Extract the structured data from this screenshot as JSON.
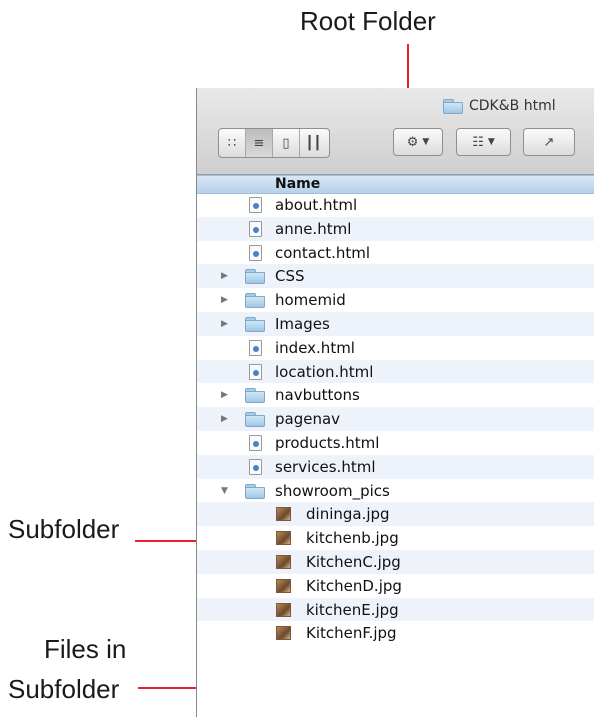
{
  "annotations": {
    "root_folder": "Root Folder",
    "subfolder": "Subfolder",
    "files_line1": "Files in",
    "files_line2": "Subfolder"
  },
  "window": {
    "title": "CDK&B html",
    "title_icon": "folder-icon"
  },
  "toolbar": {
    "view_modes": [
      "icon-view-icon",
      "list-view-icon",
      "column-view-icon",
      "coverflow-view-icon"
    ],
    "active_view": "list",
    "action_button_icon": "gear-icon",
    "arrange_button_icon": "arrange-icon",
    "share_button_icon": "share-icon"
  },
  "list": {
    "column_name": "Name",
    "rows": [
      {
        "name": "about.html",
        "type": "html",
        "expandable": false,
        "indent": 0
      },
      {
        "name": "anne.html",
        "type": "html",
        "expandable": false,
        "indent": 0
      },
      {
        "name": "contact.html",
        "type": "html",
        "expandable": false,
        "indent": 0
      },
      {
        "name": "CSS",
        "type": "folder",
        "expandable": true,
        "expanded": false,
        "indent": 0
      },
      {
        "name": "homemid",
        "type": "folder",
        "expandable": true,
        "expanded": false,
        "indent": 0
      },
      {
        "name": "Images",
        "type": "folder",
        "expandable": true,
        "expanded": false,
        "indent": 0
      },
      {
        "name": "index.html",
        "type": "html",
        "expandable": false,
        "indent": 0
      },
      {
        "name": "location.html",
        "type": "html",
        "expandable": false,
        "indent": 0
      },
      {
        "name": "navbuttons",
        "type": "folder",
        "expandable": true,
        "expanded": false,
        "indent": 0
      },
      {
        "name": "pagenav",
        "type": "folder",
        "expandable": true,
        "expanded": false,
        "indent": 0
      },
      {
        "name": "products.html",
        "type": "html",
        "expandable": false,
        "indent": 0
      },
      {
        "name": "services.html",
        "type": "html",
        "expandable": false,
        "indent": 0
      },
      {
        "name": "showroom_pics",
        "type": "folder",
        "expandable": true,
        "expanded": true,
        "indent": 0
      },
      {
        "name": "dininga.jpg",
        "type": "jpg",
        "expandable": false,
        "indent": 1
      },
      {
        "name": "kitchenb.jpg",
        "type": "jpg",
        "expandable": false,
        "indent": 1
      },
      {
        "name": "KitchenC.jpg",
        "type": "jpg",
        "expandable": false,
        "indent": 1
      },
      {
        "name": "KitchenD.jpg",
        "type": "jpg",
        "expandable": false,
        "indent": 1
      },
      {
        "name": "kitchenE.jpg",
        "type": "jpg",
        "expandable": false,
        "indent": 1
      },
      {
        "name": "KitchenF.jpg",
        "type": "jpg",
        "expandable": false,
        "indent": 1
      }
    ]
  },
  "colors": {
    "annotation_arrow": "#e8222a",
    "header_blue": "#b6d0ea",
    "alt_row": "#eef3fb"
  }
}
